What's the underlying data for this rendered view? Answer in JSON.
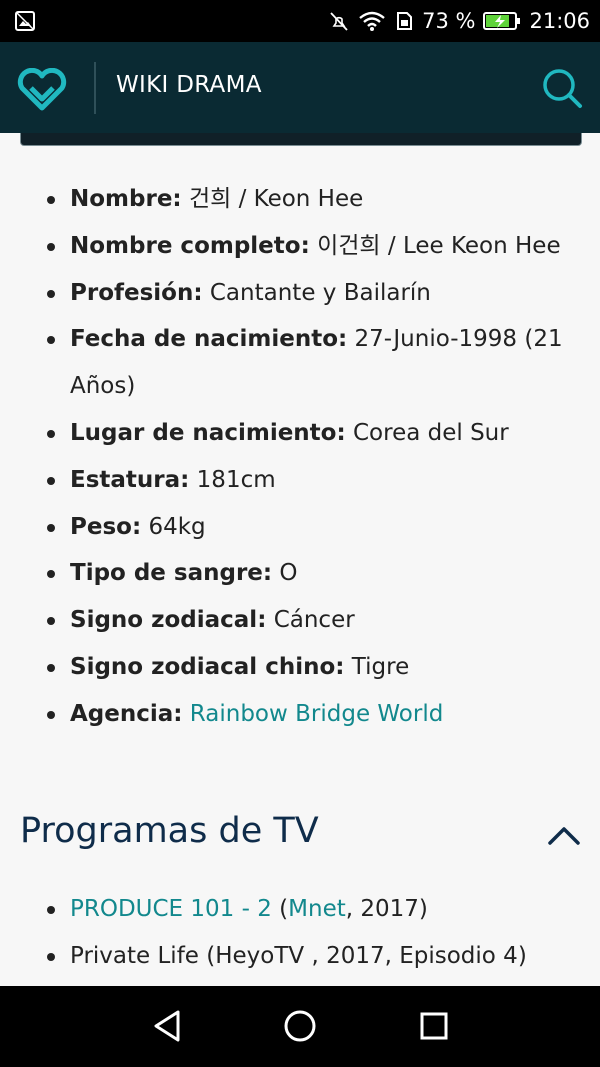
{
  "status_bar": {
    "battery_percent": "73 %",
    "time": "21:06",
    "icons": [
      "image-notification-icon",
      "mute-icon",
      "wifi-icon",
      "sim-icon",
      "battery-charging-icon"
    ]
  },
  "app_bar": {
    "title": "WIKI DRAMA",
    "logo_icon": "heart-logo-icon",
    "search_icon": "search-icon"
  },
  "bio": [
    {
      "key": "Nombre:",
      "value": "건희 / Keon Hee"
    },
    {
      "key": "Nombre completo:",
      "value": "이건희 / Lee Keon Hee"
    },
    {
      "key": "Profesión:",
      "value": "Cantante y Bailarín"
    },
    {
      "key": "Fecha de nacimiento:",
      "value": "27-Junio-1998 (21 Años)"
    },
    {
      "key": "Lugar de nacimiento:",
      "value": "Corea del Sur"
    },
    {
      "key": "Estatura:",
      "value": "181cm"
    },
    {
      "key": "Peso:",
      "value": "64kg"
    },
    {
      "key": "Tipo de sangre:",
      "value": "O"
    },
    {
      "key": "Signo zodiacal:",
      "value": "Cáncer"
    },
    {
      "key": "Signo zodiacal chino:",
      "value": "Tigre"
    },
    {
      "key": "Agencia:",
      "link": "Rainbow Bridge World"
    }
  ],
  "tv_section": {
    "title": "Programas de TV",
    "items": [
      {
        "link": "PRODUCE 101 - 2",
        "open": " (",
        "link2": "Mnet",
        "rest": ", 2017)"
      },
      {
        "text": "Private Life (HeyoTV , 2017, Episodio 4)"
      }
    ]
  },
  "colors": {
    "accent": "#12888d",
    "appbar": "#0a2a33",
    "heading": "#0f2c4a"
  },
  "nav_bar": {
    "icons": [
      "back-icon",
      "home-icon",
      "recents-icon"
    ]
  }
}
